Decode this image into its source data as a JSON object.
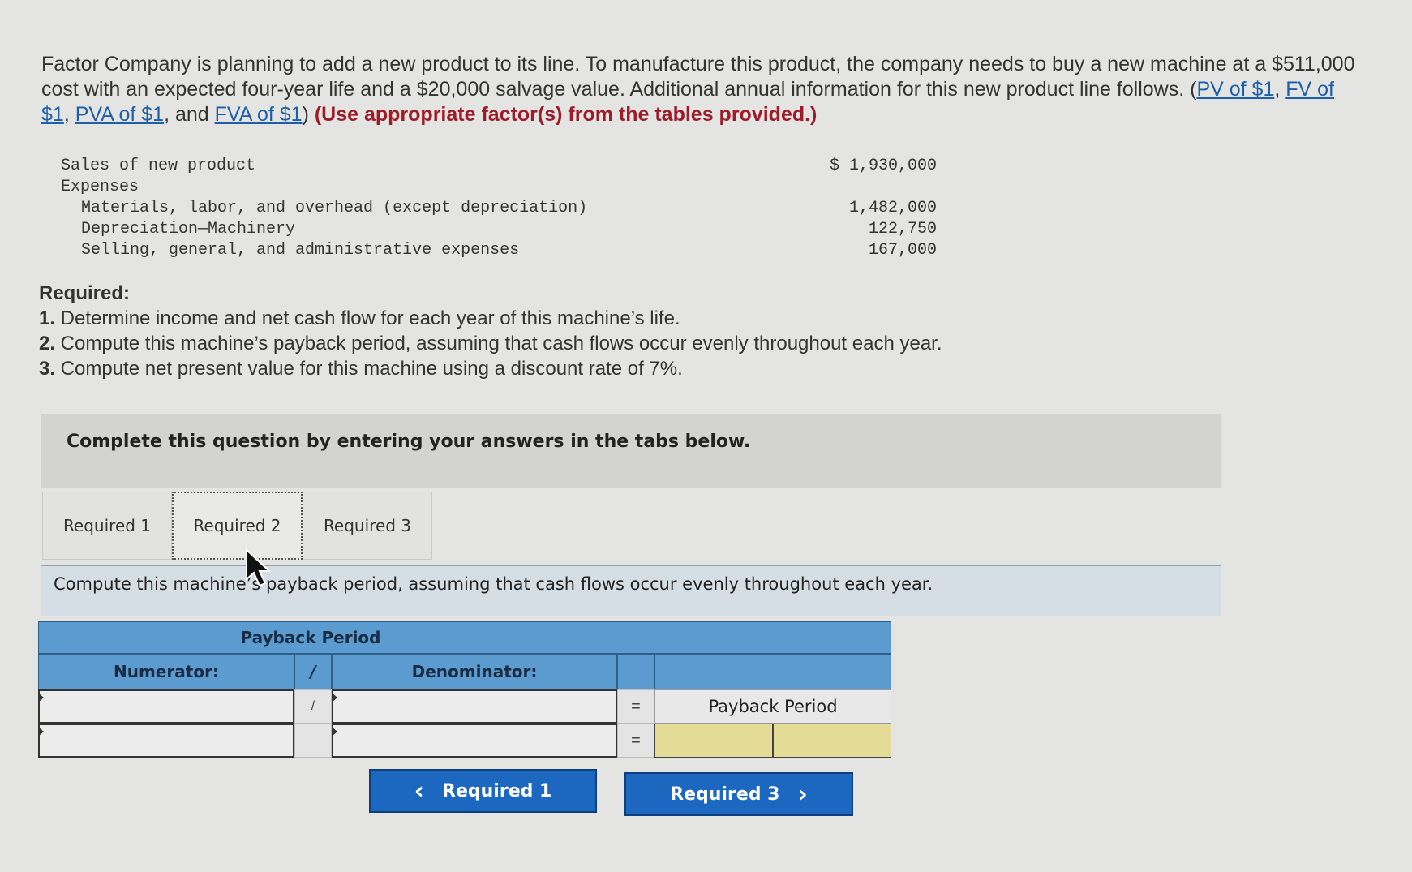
{
  "intro": {
    "text_before": "Factor Company is planning to add a new product to its line. To manufacture this product, the company needs to buy a new machine at a $511,000 cost with an expected four-year life and a $20,000 salvage value. Additional annual information for this new product line follows. (",
    "links": [
      "PV of $1",
      "FV of $1",
      "PVA of $1",
      "FVA of $1"
    ],
    "sep1": ", ",
    "sep2": ", ",
    "sep3": ", and ",
    "text_after": ")",
    "instruction": "(Use appropriate factor(s) from the tables provided.)"
  },
  "financials": {
    "rows": [
      {
        "label": "Sales of new product",
        "amount": "$ 1,930,000"
      },
      {
        "label": "Expenses",
        "amount": ""
      },
      {
        "label": "Materials, labor, and overhead (except depreciation)",
        "amount": "1,482,000"
      },
      {
        "label": "Depreciation—Machinery",
        "amount": "122,750"
      },
      {
        "label": "Selling, general, and administrative expenses",
        "amount": "167,000"
      }
    ]
  },
  "required": {
    "heading": "Required:",
    "items": [
      {
        "num": "1.",
        "text": " Determine income and net cash flow for each year of this machine’s life."
      },
      {
        "num": "2.",
        "text": " Compute this machine’s payback period, assuming that cash flows occur evenly throughout each year."
      },
      {
        "num": "3.",
        "text": " Compute net present value for this machine using a discount rate of 7%."
      }
    ]
  },
  "banner": "Complete this question by entering your answers in the tabs below.",
  "tabs": [
    {
      "label": "Required 1",
      "active": false
    },
    {
      "label": "Required 2",
      "active": true
    },
    {
      "label": "Required 3",
      "active": false
    }
  ],
  "instruction": "Compute this machine’s payback period, assuming that cash flows occur evenly throughout each year.",
  "table": {
    "title": "Payback Period",
    "numerator_label": "Numerator:",
    "divide_symbol": "/",
    "denominator_label": "Denominator:",
    "equals_symbol": "=",
    "result_label": "Payback Period",
    "row1": {
      "numerator": "",
      "denominator": ""
    },
    "row2": {
      "numerator": "",
      "denominator": "",
      "result_value": "",
      "result_unit": ""
    }
  },
  "nav": {
    "prev_label": "Required 1",
    "prev_icon": "‹",
    "next_label": "Required 3",
    "next_icon": "›"
  }
}
